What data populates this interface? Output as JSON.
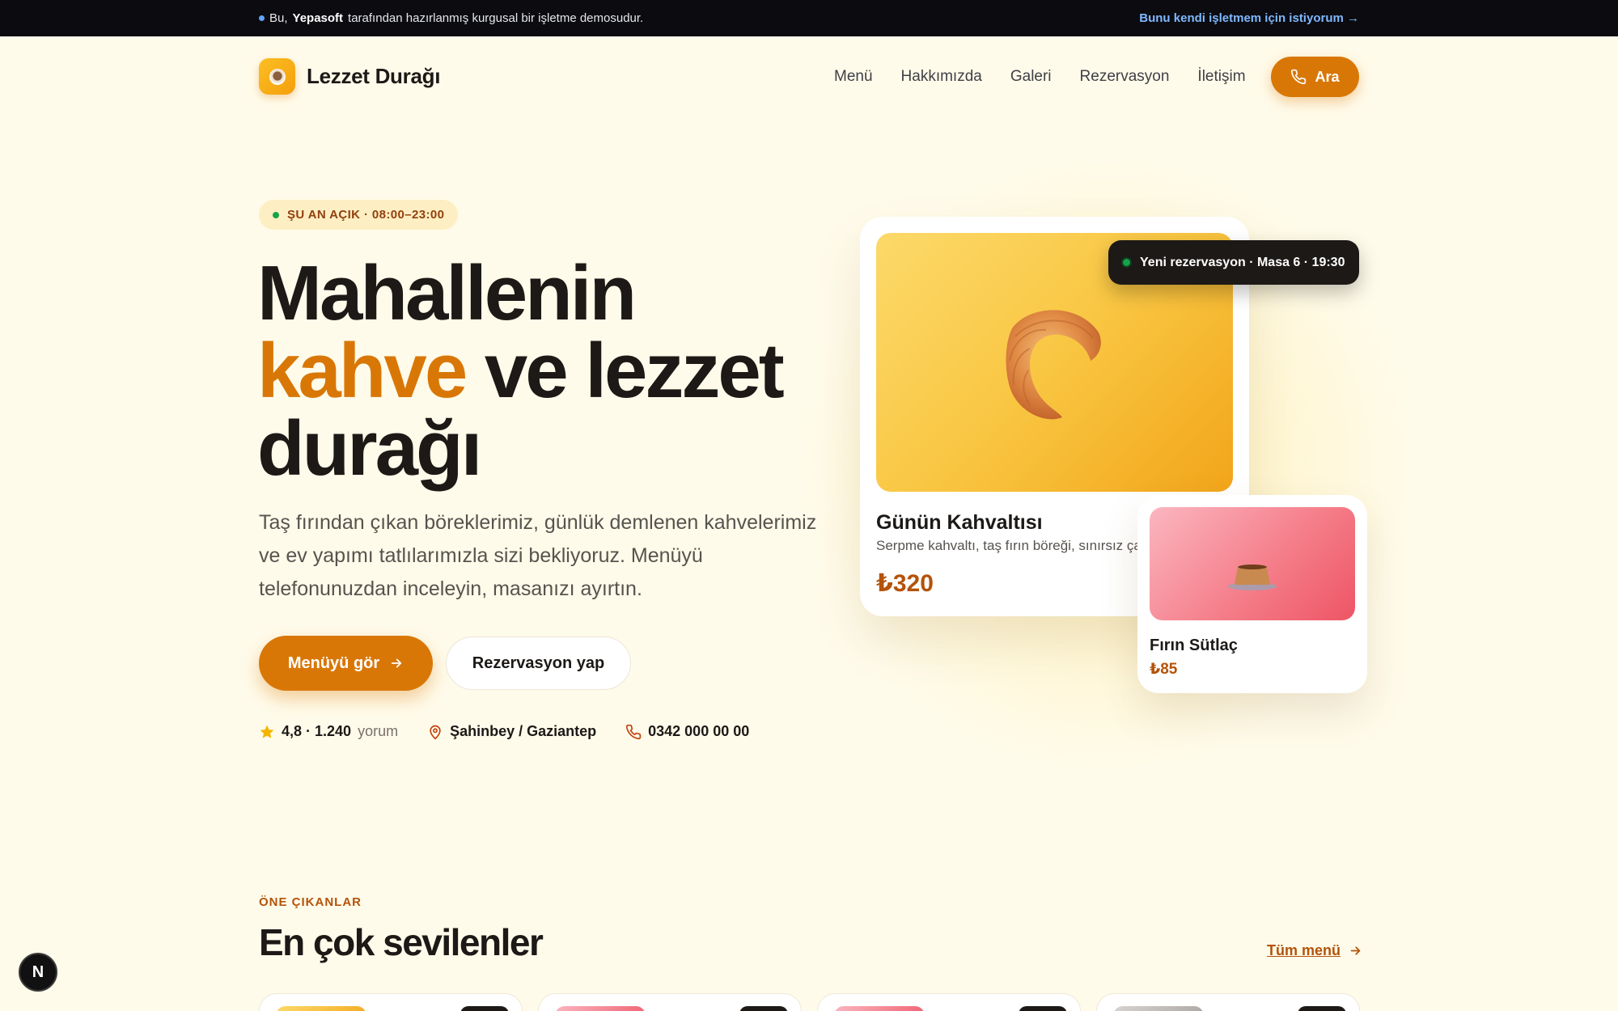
{
  "topbar": {
    "notice_prefix": "Bu,",
    "notice_brand": "Yepasoft",
    "notice_suffix": "tarafından hazırlanmış kurgusal bir işletme demosudur.",
    "cta": "Bunu kendi işletmem için istiyorum →"
  },
  "header": {
    "logo_text": "Lezzet Durağı",
    "nav": [
      "Menü",
      "Hakkımızda",
      "Galeri",
      "Rezervasyon",
      "İletişim"
    ],
    "call_label": "Ara"
  },
  "hero": {
    "badge": "ŞU AN AÇIK · 08:00–23:00",
    "title_line1": "Mahallenin",
    "title_accent": "kahve",
    "title_line2_rest": " ve lezzet",
    "title_line3": "durağı",
    "subtitle": "Taş fırından çıkan böreklerimiz, günlük demlenen kahvelerimiz ve ev yapımı tatlılarımızla sizi bekliyoruz. Menüyü telefonunuzdan inceleyin, masanızı ayırtın.",
    "primary_cta": "Menüyü gör",
    "secondary_cta": "Rezervasyon yap",
    "rating": "4,8 · 1.240",
    "rating_suffix": "yorum",
    "location": "Şahinbey / Gaziantep",
    "phone": "0342 000 00 00"
  },
  "featured_card": {
    "title": "Günün Kahvaltısı",
    "description": "Serpme kahvaltı, taş fırın böreği, sınırsız çay",
    "price": "₺320"
  },
  "toast": {
    "text": "Yeni rezervasyon · Masa 6 · 19:30"
  },
  "small_card": {
    "title": "Fırın Sütlaç",
    "price": "₺85"
  },
  "section": {
    "eyebrow": "ÖNE ÇIKANLAR",
    "title": "En çok sevilenler",
    "all_menu": "Tüm menü"
  },
  "colors": {
    "accent": "#d97706",
    "price": "#b45309",
    "background": "#fffbea",
    "dark": "#1c1917",
    "live": "#16a34a"
  },
  "dev_badge": "N"
}
